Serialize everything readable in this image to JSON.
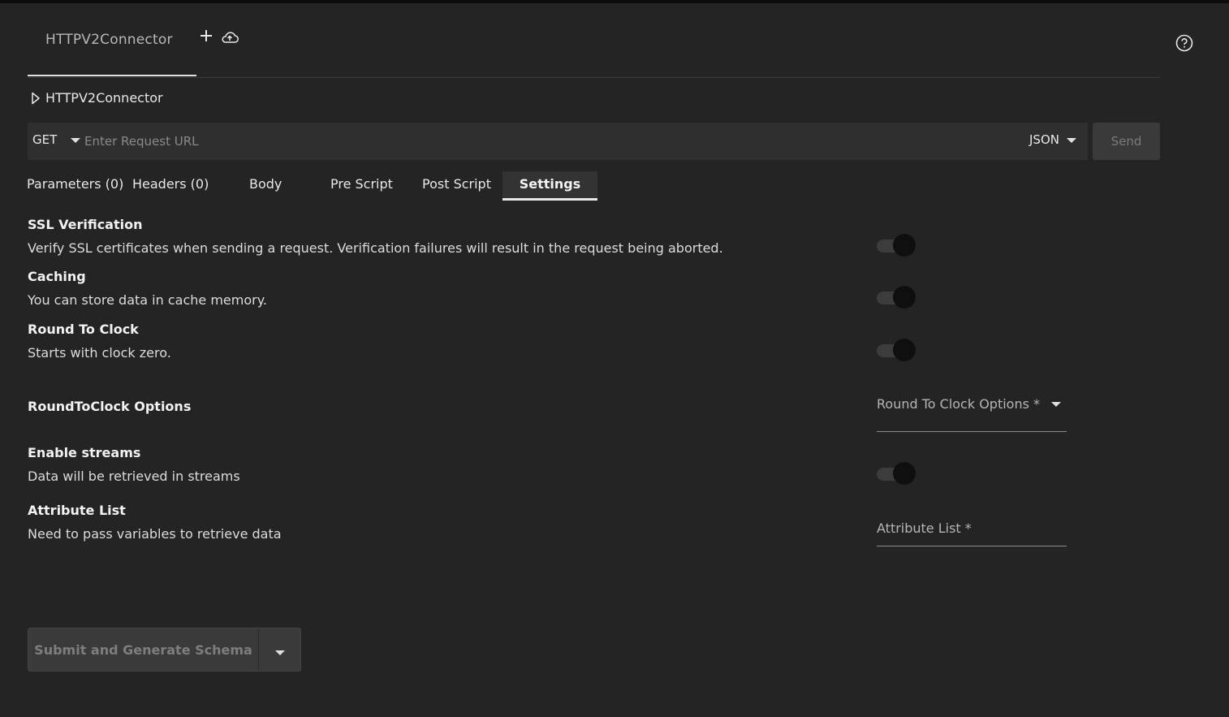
{
  "header": {
    "tab_label": "HTTPV2Connector",
    "add_tab_icon": "plus-icon",
    "upload_icon": "cloud-upload-icon",
    "help_icon": "help-circle-icon"
  },
  "breadcrumb": {
    "icon": "play-outline-icon",
    "label": "HTTPV2Connector"
  },
  "request": {
    "method": "GET",
    "url_value": "",
    "url_placeholder": "Enter Request URL",
    "format": "JSON",
    "send_label": "Send"
  },
  "subtabs": {
    "parameters": "Parameters (0)",
    "headers": "Headers (0)",
    "body": "Body",
    "pre_script": "Pre Script",
    "post_script": "Post Script",
    "settings": "Settings",
    "active": "Settings"
  },
  "settings": {
    "ssl": {
      "title": "SSL Verification",
      "description": "Verify SSL certificates when sending a request. Verification failures will result in the request being aborted.",
      "enabled": true
    },
    "caching": {
      "title": "Caching",
      "description": "You can store data in cache memory.",
      "enabled": true
    },
    "round_to_clock": {
      "title": "Round To Clock",
      "description": "Starts with clock zero.",
      "enabled": true
    },
    "round_options": {
      "title": "RoundToClock Options",
      "field_label": "Round To Clock Options *"
    },
    "streams": {
      "title": "Enable streams",
      "description": "Data will be retrieved in streams",
      "enabled": true
    },
    "attributes": {
      "title": "Attribute List",
      "description": "Need to pass variables to retrieve data",
      "field_label": "Attribute List *"
    }
  },
  "footer": {
    "submit_label": "Submit and Generate Schema"
  }
}
